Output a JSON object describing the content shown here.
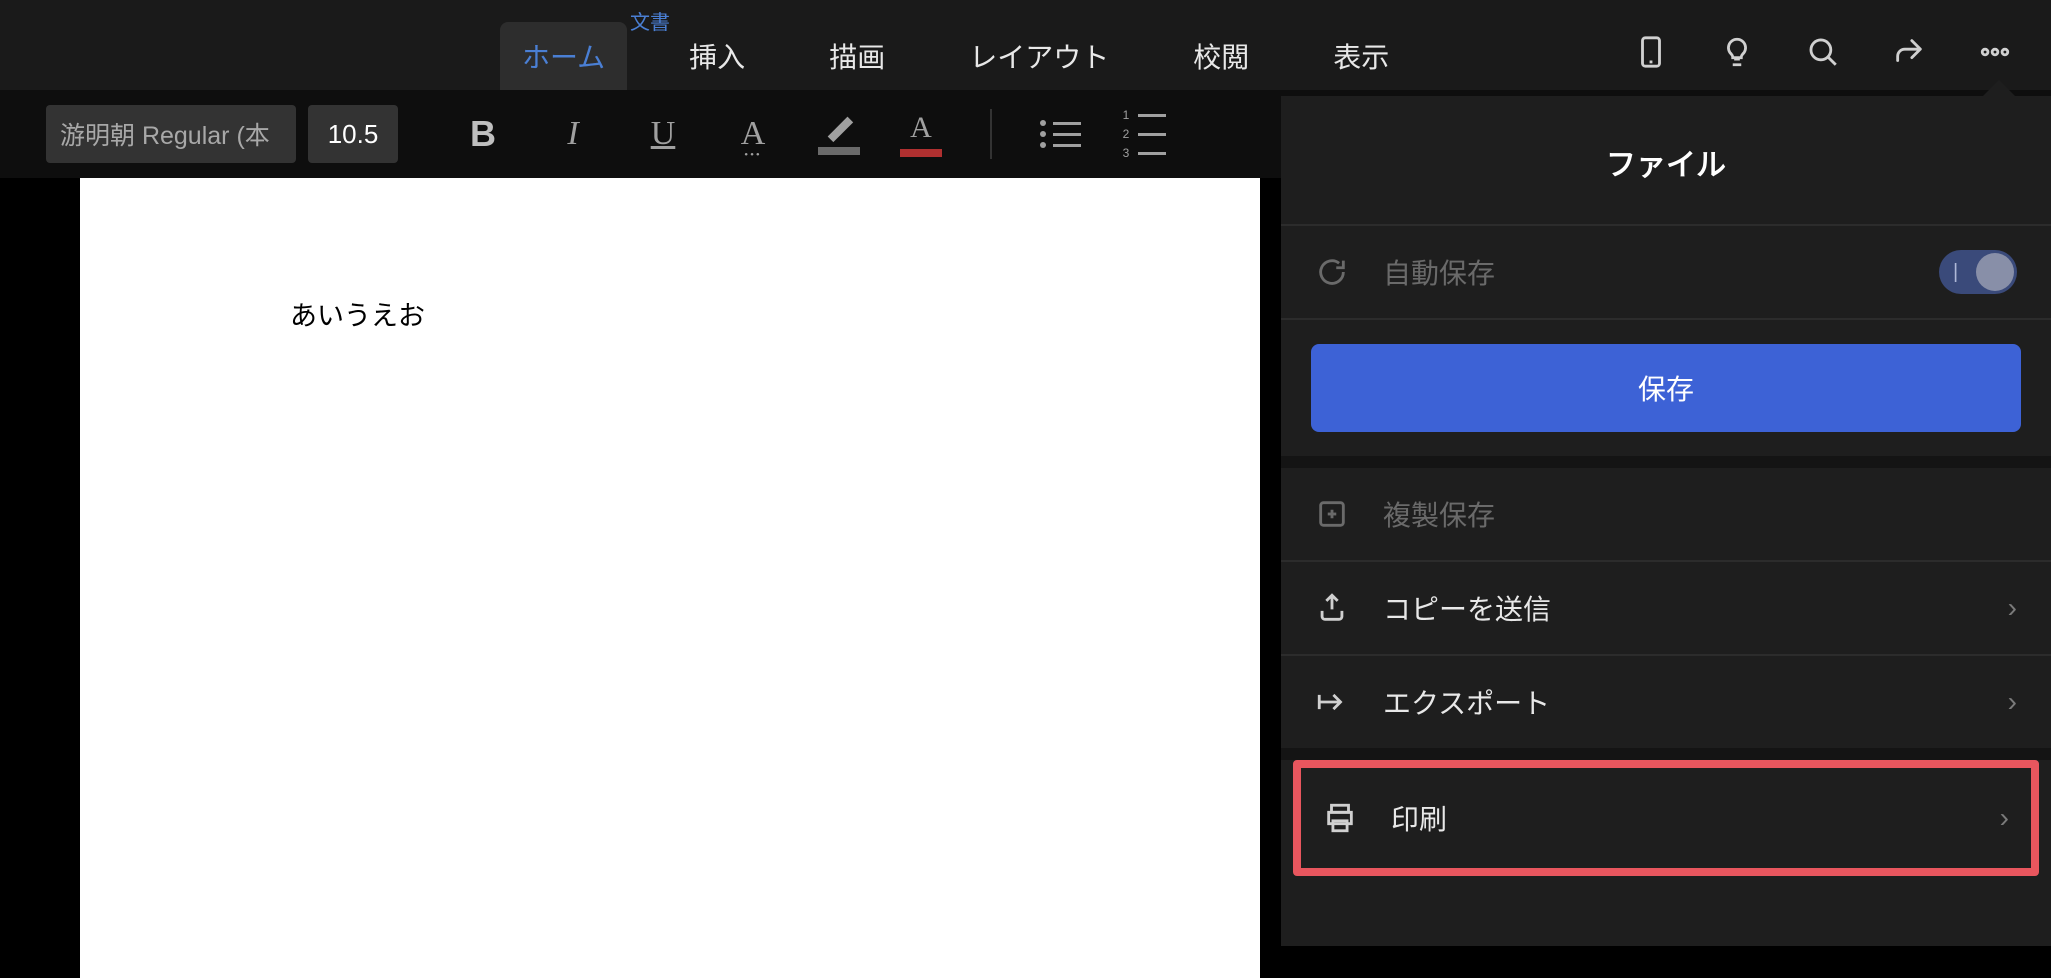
{
  "header": {
    "doc_title": "文書",
    "tabs": {
      "home": "ホーム",
      "insert": "挿入",
      "draw": "描画",
      "layout": "レイアウト",
      "review": "校閲",
      "view": "表示"
    }
  },
  "toolbar": {
    "font_name": "游明朝 Regular (本",
    "font_size": "10.5",
    "bold": "B",
    "italic": "I",
    "underline": "U",
    "strike": "A",
    "font_color_letter": "A",
    "numlist": {
      "n1": "1",
      "n2": "2",
      "n3": "3"
    }
  },
  "document": {
    "body_text": "あいうえお"
  },
  "file_panel": {
    "title": "ファイル",
    "autosave": "自動保存",
    "save_button": "保存",
    "save_copy": "複製保存",
    "send_copy": "コピーを送信",
    "export": "エクスポート",
    "print": "印刷"
  }
}
